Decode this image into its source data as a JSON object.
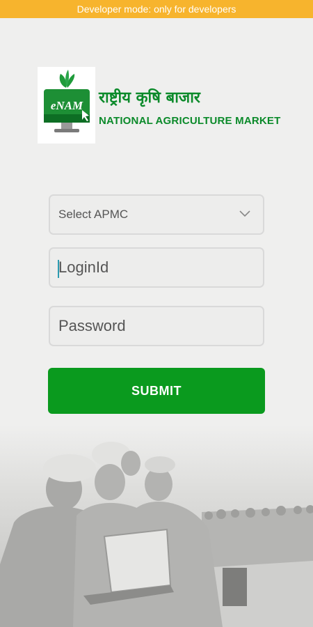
{
  "dev_banner": "Developer mode: only for developers",
  "logo": {
    "badge_text": "eNAM",
    "title_hindi": "राष्ट्रीय कृषि बाजार",
    "title_english": "NATIONAL AGRICULTURE MARKET"
  },
  "form": {
    "apmc_select": "Select APMC",
    "login_placeholder": "LoginId",
    "password_placeholder": "Password",
    "submit_label": "SUBMIT"
  },
  "colors": {
    "dev_banner": "#f7b42d",
    "brand_green": "#0b8a2a",
    "submit_green": "#0a9a1e"
  }
}
